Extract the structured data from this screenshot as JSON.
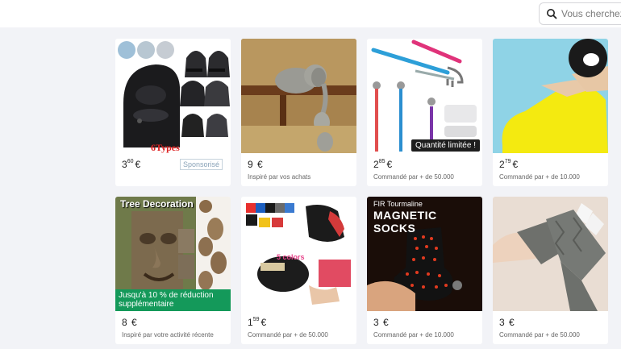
{
  "search": {
    "placeholder": "Vous cherchez q"
  },
  "products": [
    {
      "price_int": "3",
      "price_dec": "60",
      "currency": "€",
      "caption": "",
      "sponsored_label": "Sponsorisé",
      "image_text": "6Types"
    },
    {
      "price_int": "9",
      "price_dec": "",
      "currency": "€",
      "caption": "Inspiré par vos achats"
    },
    {
      "price_int": "2",
      "price_dec": "85",
      "currency": "€",
      "caption": "Commandé par + de 50.000",
      "badge": "Quantité limitée !"
    },
    {
      "price_int": "2",
      "price_dec": "79",
      "currency": "€",
      "caption": "Commandé par + de 10.000"
    },
    {
      "price_int": "8",
      "price_dec": "",
      "currency": "€",
      "caption": "Inspiré par votre activité récente",
      "image_title": "Tree Decoration",
      "promo": "Jusqu'à 10 % de réduction supplémentaire"
    },
    {
      "price_int": "1",
      "price_dec": "59",
      "currency": "€",
      "caption": "Commandé par + de 50.000",
      "image_text": "5 colors"
    },
    {
      "price_int": "3",
      "price_dec": "",
      "currency": "€",
      "caption": "Commandé par + de 10.000",
      "image_title_small": "FIR Tourmaline",
      "image_title": "MAGNETIC SOCKS"
    },
    {
      "price_int": "3",
      "price_dec": "",
      "currency": "€",
      "caption": "Commandé par + de 50.000"
    }
  ]
}
